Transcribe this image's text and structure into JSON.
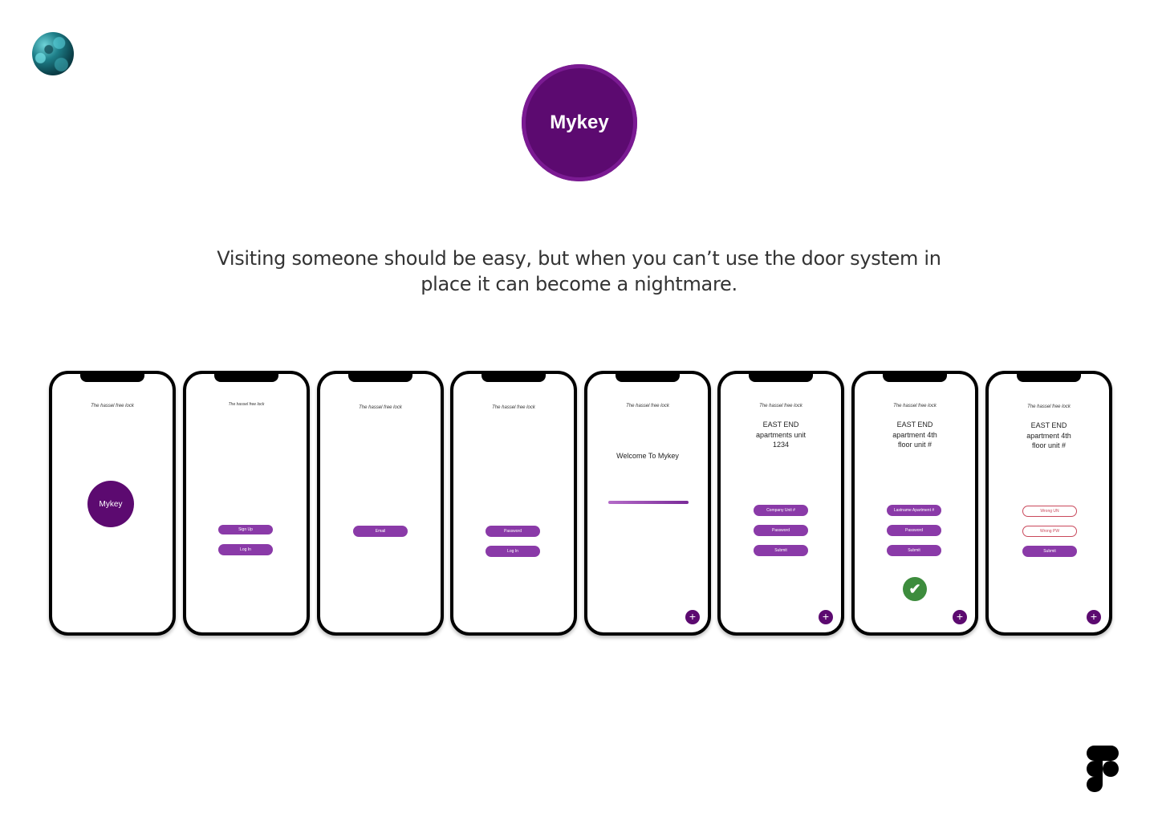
{
  "brand": {
    "logo_text": "Mykey"
  },
  "tagline": "Visiting someone should be easy, but when you can’t use the door system in place it can become a nightmare.",
  "colors": {
    "primary": "#5c0a70",
    "button": "#8a3aa8",
    "error": "#c9485b",
    "success": "#3d8c3d"
  },
  "icons": {
    "avatar": "profile-photo",
    "figma": "figma-logo",
    "fab": "plus-icon",
    "check": "checkmark-icon"
  },
  "screens": [
    {
      "app_title": "The hassel free lock",
      "logo": "Mykey"
    },
    {
      "app_title": "The hassel free lock",
      "buttons": [
        "Sign Up",
        "Log In"
      ]
    },
    {
      "app_title": "The hassel free lock",
      "buttons": [
        "Email"
      ]
    },
    {
      "app_title": "The hassel free lock",
      "buttons": [
        "Password",
        "Log In"
      ]
    },
    {
      "app_title": "The hassel free lock",
      "welcome": "Welcome To Mykey",
      "fab": "+"
    },
    {
      "app_title": "The hassel free lock",
      "heading": "EAST END apartments unit 1234",
      "buttons": [
        "Company Unit #",
        "Password",
        "Submit"
      ],
      "fab": "+"
    },
    {
      "app_title": "The hassel free lock",
      "heading": "EAST END apartment 4th floor unit #",
      "buttons": [
        "Lastname Apartment #",
        "Password",
        "Submit"
      ],
      "check": "✔",
      "fab": "+"
    },
    {
      "app_title": "The hassel free lock",
      "heading": "EAST END apartment 4th floor unit #",
      "error_fields": [
        "Wrong UN",
        "Wrong PW"
      ],
      "buttons": [
        "Submit"
      ],
      "fab": "+"
    }
  ]
}
